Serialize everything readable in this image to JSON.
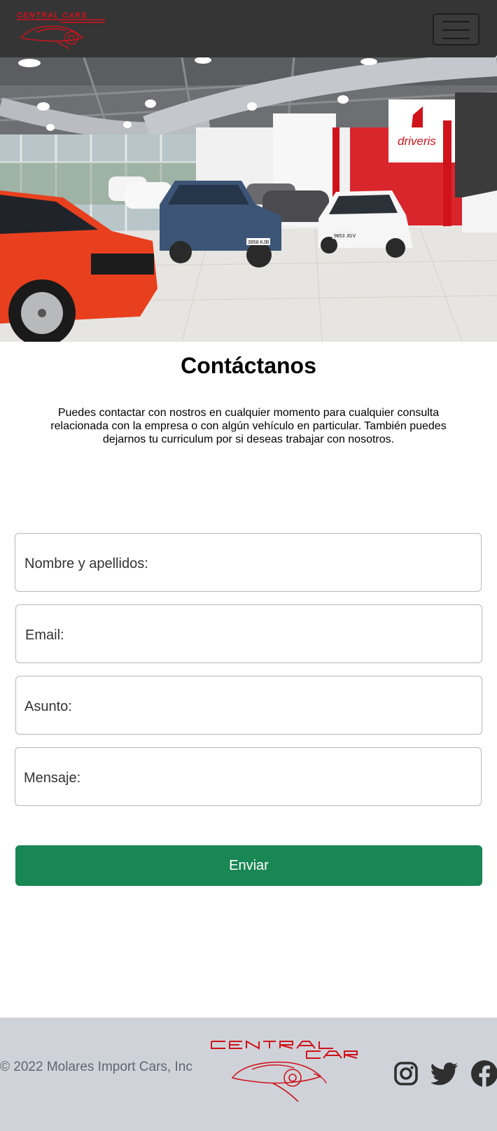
{
  "brand": {
    "name": "CENTRAL CARS",
    "accent_color": "#d0121b"
  },
  "navbar": {
    "toggler_icon": "hamburger-menu-icon",
    "background": "#353535"
  },
  "hero": {
    "showroom_sign": "driveris",
    "plate_1": "3958 KJB",
    "plate_2": "9853 JGV"
  },
  "contact": {
    "title": "Contáctanos",
    "intro": "Puedes contactar con nostros en cualquier momento para cualquier consulta relacionada con la empresa o con algún vehículo en particular. También puedes dejarnos tu curriculum por si deseas trabajar con nosotros."
  },
  "form": {
    "name_label": "Nombre y apellidos:",
    "email_label": "Email:",
    "subject_label": "Asunto:",
    "message_label": "Mensaje:",
    "submit_label": "Enviar",
    "submit_color": "#198754"
  },
  "footer": {
    "copyright": "© 2022 Molares Import Cars, Inc",
    "social": [
      "instagram-icon",
      "twitter-icon",
      "facebook-icon"
    ],
    "background": "#cfd3d9"
  }
}
